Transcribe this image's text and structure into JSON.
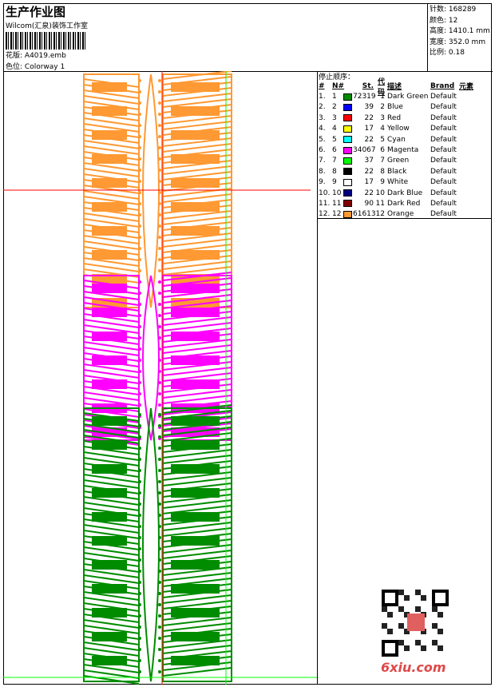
{
  "header": {
    "title": "生产作业图",
    "company": "Wilcom(汇泉)装饰工作室",
    "design_label": "花版:",
    "design_value": "A4019.emb",
    "colorway_label": "色位:",
    "colorway_value": "Colorway 1"
  },
  "info": [
    {
      "label": "针数:",
      "value": "168289"
    },
    {
      "label": "颜色:",
      "value": "12"
    },
    {
      "label": "高度:",
      "value": "1410.1 mm"
    },
    {
      "label": "宽度:",
      "value": "352.0 mm"
    },
    {
      "label": "比例:",
      "value": "0.18"
    }
  ],
  "stop_sequence": {
    "title": "停止顺序：",
    "columns": [
      "#",
      "N#",
      "",
      "St.",
      "代码",
      "描述",
      "Brand",
      "元素"
    ],
    "rows": [
      {
        "idx": "1.",
        "n": "1",
        "color": "#008c00",
        "st": "72319",
        "code": "1",
        "desc": "Dark Green",
        "brand": "Default"
      },
      {
        "idx": "2.",
        "n": "2",
        "color": "#0000ff",
        "st": "39",
        "code": "2",
        "desc": "Blue",
        "brand": "Default"
      },
      {
        "idx": "3.",
        "n": "3",
        "color": "#ff0000",
        "st": "22",
        "code": "3",
        "desc": "Red",
        "brand": "Default"
      },
      {
        "idx": "4.",
        "n": "4",
        "color": "#ffff00",
        "st": "17",
        "code": "4",
        "desc": "Yellow",
        "brand": "Default"
      },
      {
        "idx": "5.",
        "n": "5",
        "color": "#00ffff",
        "st": "22",
        "code": "5",
        "desc": "Cyan",
        "brand": "Default"
      },
      {
        "idx": "6.",
        "n": "6",
        "color": "#ff00ff",
        "st": "34067",
        "code": "6",
        "desc": "Magenta",
        "brand": "Default"
      },
      {
        "idx": "7.",
        "n": "7",
        "color": "#00ff00",
        "st": "37",
        "code": "7",
        "desc": "Green",
        "brand": "Default"
      },
      {
        "idx": "8.",
        "n": "8",
        "color": "#000000",
        "st": "22",
        "code": "8",
        "desc": "Black",
        "brand": "Default"
      },
      {
        "idx": "9.",
        "n": "9",
        "color": "#ffffff",
        "st": "17",
        "code": "9",
        "desc": "White",
        "brand": "Default"
      },
      {
        "idx": "10.",
        "n": "10",
        "color": "#000080",
        "st": "22",
        "code": "10",
        "desc": "Dark Blue",
        "brand": "Default"
      },
      {
        "idx": "11.",
        "n": "11",
        "color": "#800000",
        "st": "90",
        "code": "11",
        "desc": "Dark Red",
        "brand": "Default"
      },
      {
        "idx": "12.",
        "n": "12",
        "color": "#ff9933",
        "st": "61613",
        "code": "12",
        "desc": "Orange",
        "brand": "Default"
      }
    ]
  },
  "watermark": "6xiu.com"
}
